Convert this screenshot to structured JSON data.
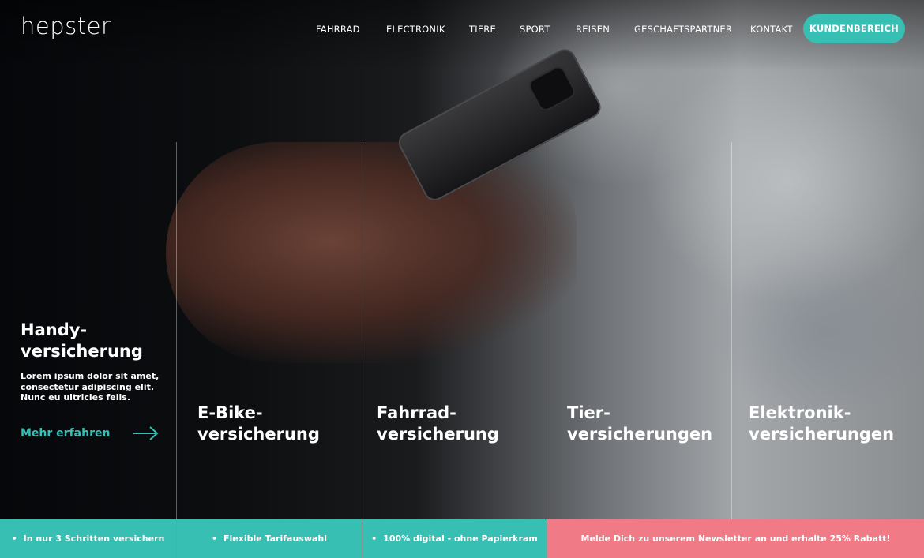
{
  "brand": {
    "logo": "hepster",
    "accent": "#37bfb4",
    "newsletter_bg": "#f07b86"
  },
  "nav": {
    "items": [
      "FAHRRAD",
      "ELECTRONIK",
      "TIERE",
      "SPORT",
      "REISEN",
      "GESCHAFTSPARTNER",
      "KONTAKT"
    ],
    "cta": "KUNDENBEREICH"
  },
  "hero": {
    "featured": {
      "title_line1": "Handy-",
      "title_line2": "versicherung",
      "description": "Lorem ipsum dolor sit amet, consectetur adipiscing elit. Nunc eu ultricies felis.",
      "link_label": "Mehr erfahren",
      "link_icon": "arrow-right-icon"
    },
    "categories": [
      {
        "line1": "E-Bike-",
        "line2": "versicherung"
      },
      {
        "line1": "Fahrrad-",
        "line2": "versicherung"
      },
      {
        "line1": "Tier-",
        "line2": "versicherungen"
      },
      {
        "line1": "Elektronik-",
        "line2": "versicherungen"
      }
    ]
  },
  "bottom_bar": {
    "bullet": "•",
    "features": [
      "In nur 3 Schritten versichern",
      "Flexible Tarifauswahl",
      "100% digital - ohne Papierkram"
    ],
    "newsletter": "Melde Dich zu unserem Newsletter an und erhalte 25% Rabatt!"
  }
}
